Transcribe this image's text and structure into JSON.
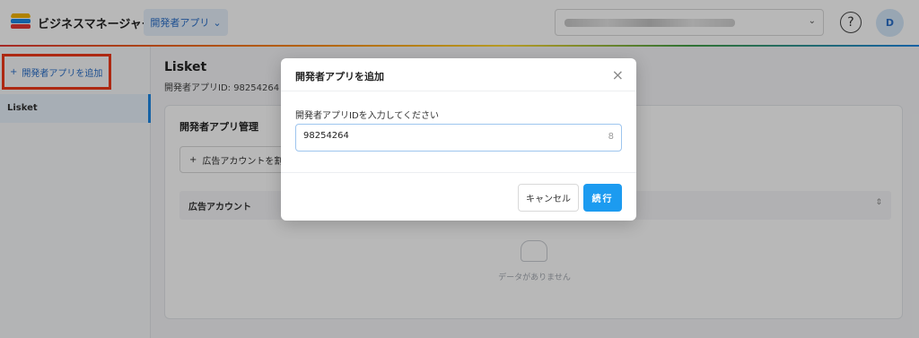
{
  "header": {
    "brand": "ビジネスマネージャー",
    "app_menu": "開発者アプリ",
    "app_menu_caret": "⌄",
    "account_caret": "⌄",
    "help": "?",
    "avatar": "D"
  },
  "sidebar": {
    "add_app_icon": "+",
    "add_app_label": "開発者アプリを追加",
    "items": [
      {
        "label": "Lisket"
      }
    ]
  },
  "main": {
    "title": "Lisket",
    "subtitle": "開発者アプリID: 98254264",
    "card_title": "開発者アプリ管理",
    "assign_icon": "+",
    "assign_label": "広告アカウントを割り当て",
    "table_header": "広告アカウント",
    "sort_icon": "⇕",
    "empty_text": "データがありません"
  },
  "modal": {
    "title": "開発者アプリを追加",
    "close": "×",
    "field_label": "開発者アプリIDを入力してください",
    "field_value": "98254264",
    "char_count": "8",
    "cancel": "キャンセル",
    "continue": "続行"
  },
  "colors": {
    "accent": "#1c9bf0",
    "highlight_border": "#f0391a",
    "link": "#2a6fc9"
  }
}
